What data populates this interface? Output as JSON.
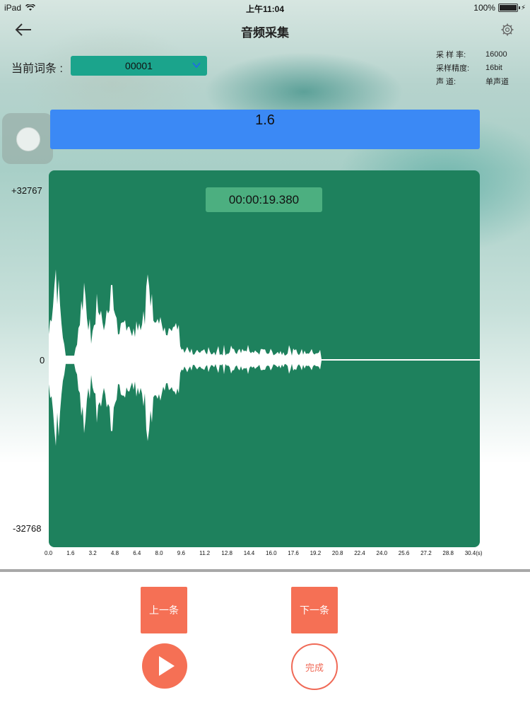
{
  "status_bar": {
    "device": "iPad",
    "time": "上午11:04",
    "battery": "100%"
  },
  "nav": {
    "title": "音频采集",
    "back_icon": "back-arrow-icon",
    "settings_icon": "gear-icon"
  },
  "entry": {
    "label": "当前词条 :",
    "value": "00001"
  },
  "info": [
    {
      "key": "采 样 率:",
      "value": "16000"
    },
    {
      "key": "采样精度:",
      "value": "16bit"
    },
    {
      "key": "声    道:",
      "value": "单声道"
    }
  ],
  "level": {
    "value": "1.6"
  },
  "waveform": {
    "timer": "00:00:19.380",
    "y_top": "+32767",
    "y_mid": "0",
    "y_bottom": "-32768",
    "x_ticks": [
      "0.0",
      "1.6",
      "3.2",
      "4.8",
      "6.4",
      "8.0",
      "9.6",
      "11.2",
      "12.8",
      "14.4",
      "16.0",
      "17.6",
      "19.2",
      "20.8",
      "22.4",
      "24.0",
      "25.6",
      "27.2",
      "28.8",
      "30.4(s)"
    ],
    "colors": {
      "panel": "#1e815d",
      "wave": "#ffffff"
    }
  },
  "buttons": {
    "prev": "上一条",
    "next": "下一条",
    "done": "完成",
    "play_icon": "play-icon"
  }
}
